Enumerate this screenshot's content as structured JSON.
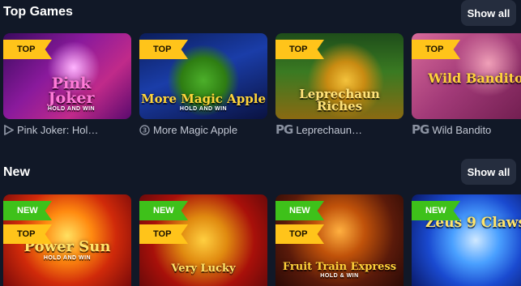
{
  "top_games": {
    "title": "Top Games",
    "show_all": "Show all",
    "cards": [
      {
        "game_logo": "Pink Joker",
        "logo_sub": "HOLD AND WIN",
        "badge": "TOP",
        "provider_icon": "play-triangle-icon",
        "caption": "Pink Joker: Hol…"
      },
      {
        "game_logo": "More Magic Apple",
        "logo_sub": "HOLD AND WIN",
        "badge": "TOP",
        "provider_icon": "spiral-3-icon",
        "caption": "More Magic Apple"
      },
      {
        "game_logo": "Leprechaun Riches",
        "badge": "TOP",
        "provider_icon": "pg-logo-icon",
        "provider_text": "PG",
        "caption": "Leprechaun…"
      },
      {
        "game_logo": "Wild Bandito",
        "badge": "TOP",
        "provider_icon": "pg-logo-icon",
        "provider_text": "PG",
        "caption": "Wild Bandito"
      }
    ]
  },
  "new_games": {
    "title": "New",
    "show_all": "Show all",
    "cards": [
      {
        "game_logo": "Power Sun",
        "logo_sub": "HOLD AND WIN",
        "badge_new": "NEW",
        "badge_top": "TOP"
      },
      {
        "game_logo": "Very Lucky",
        "badge_new": "NEW",
        "badge_top": "TOP"
      },
      {
        "game_logo": "Fruit Train Express",
        "logo_sub": "HOLD & WIN",
        "badge_new": "NEW",
        "badge_top": "TOP"
      },
      {
        "game_logo": "Zeus 9 Claws",
        "badge_new": "NEW"
      }
    ]
  },
  "colors": {
    "background": "#111827",
    "badge_top": "#ffc41a",
    "badge_new": "#3ec11a",
    "button_bg": "#252d3e"
  }
}
